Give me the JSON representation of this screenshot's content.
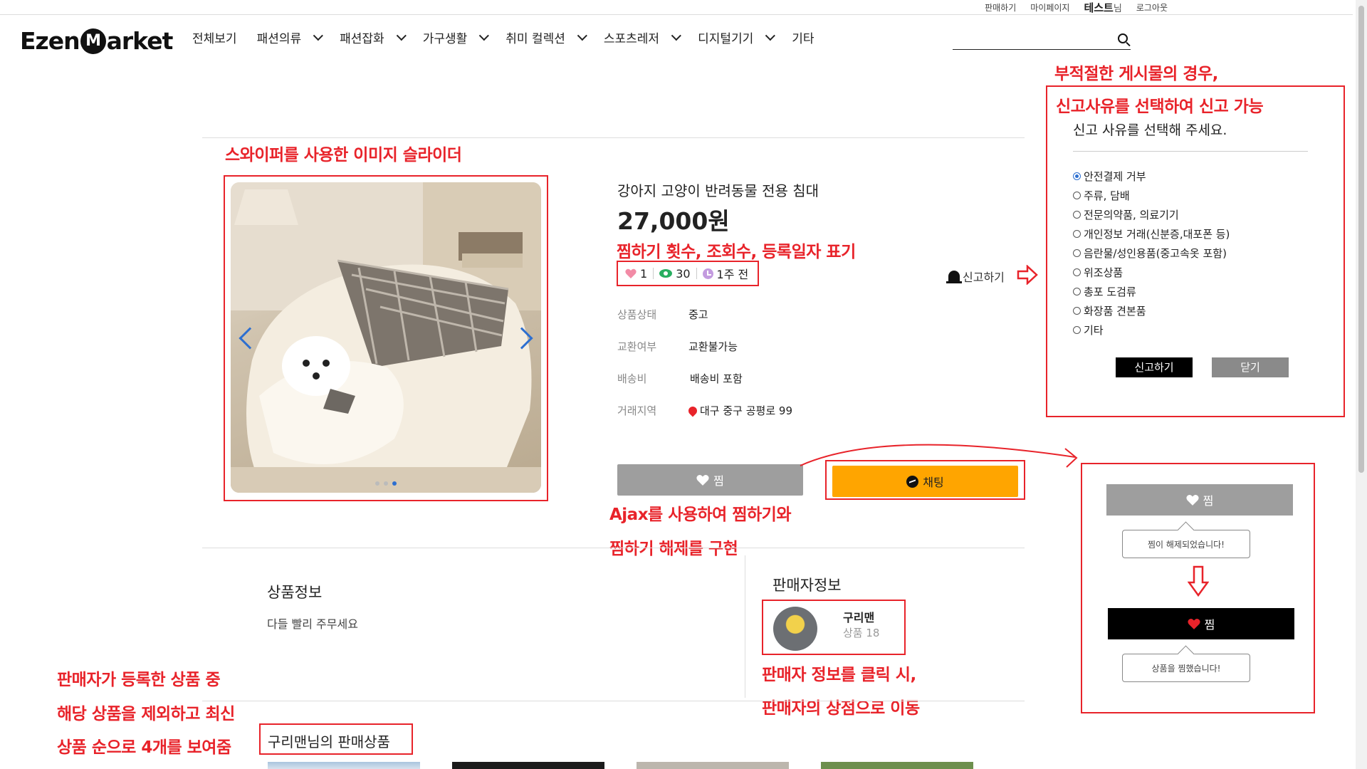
{
  "util_bar": {
    "sell": "판매하기",
    "mypage": "마이페이지",
    "user_name": "테스트",
    "user_suffix": "님",
    "logout": "로그아웃"
  },
  "logo": {
    "before": "Ezen",
    "middle": "M",
    "after": "arket"
  },
  "nav": {
    "items": [
      {
        "label": "전체보기",
        "dropdown": false
      },
      {
        "label": "패션의류",
        "dropdown": true
      },
      {
        "label": "패션잡화",
        "dropdown": true
      },
      {
        "label": "가구생활",
        "dropdown": true
      },
      {
        "label": "취미 컬렉션",
        "dropdown": true
      },
      {
        "label": "스포츠레저",
        "dropdown": true
      },
      {
        "label": "디지털기기",
        "dropdown": true
      },
      {
        "label": "기타",
        "dropdown": false
      }
    ]
  },
  "search": {
    "placeholder": "",
    "icon": "search-icon"
  },
  "annotations": {
    "slider": "스와이퍼를 사용한 이미지 슬라이더",
    "stats": "찜하기 횟수, 조회수, 등록일자 표기",
    "report_1": "부적절한 게시물의 경우,",
    "report_2": "신고사유를 선택하여 신고 가능",
    "ajax_1": "Ajax를 사용하여 찜하기와",
    "ajax_2": "찜하기 해제를 구현",
    "seller_1": "판매자 정보를 클릭 시,",
    "seller_2": "판매자의 상점으로 이동",
    "others_1": "판매자가 등록한 상품 중",
    "others_2": "해당 상품을 제외하고 최신",
    "others_3": "상품 순으로 4개를 보여줌"
  },
  "product": {
    "title": "강아지 고양이 반려동물 전용 침대",
    "price": "27,000원",
    "likes": "1",
    "views": "30",
    "posted": "1주 전",
    "specs": [
      {
        "key": "상품상태",
        "value": "중고"
      },
      {
        "key": "교환여부",
        "value": "교환불가능"
      },
      {
        "key": "배송비",
        "value": "배송비 포함"
      },
      {
        "key": "거래지역",
        "value": "대구 중구 공평로 99"
      }
    ],
    "zzim_label": "찜",
    "chat_label": "채팅",
    "report_label": "신고하기"
  },
  "slider": {
    "slide_count": 3,
    "active_index": 2
  },
  "report_modal": {
    "title": "신고 사유를 선택해 주세요.",
    "options": [
      "안전결제 거부",
      "주류, 담배",
      "전문의약품, 의료기기",
      "개인정보 거래(신분증,대포폰 등)",
      "음란물/성인용품(중고속옷 포함)",
      "위조상품",
      "총포 도검류",
      "화장품 견본품",
      "기타"
    ],
    "selected_index": 0,
    "submit": "신고하기",
    "close": "닫기"
  },
  "zzim_demo": {
    "before_label": "찜",
    "before_msg": "찜이 해제되었습니다!",
    "after_label": "찜",
    "after_msg": "상품을 찜했습니다!"
  },
  "info": {
    "title": "상품정보",
    "desc": "다들 빨리 주무세요"
  },
  "seller": {
    "section_title": "판매자정보",
    "name": "구리맨",
    "count": "상품 18"
  },
  "seller_products": {
    "title": "구리맨님의 판매상품"
  },
  "colors": {
    "accent_red": "#e8232a",
    "chat_orange": "#ffa500",
    "zzim_gray": "#9e9e9e",
    "active_blue": "#2d6fd0"
  }
}
